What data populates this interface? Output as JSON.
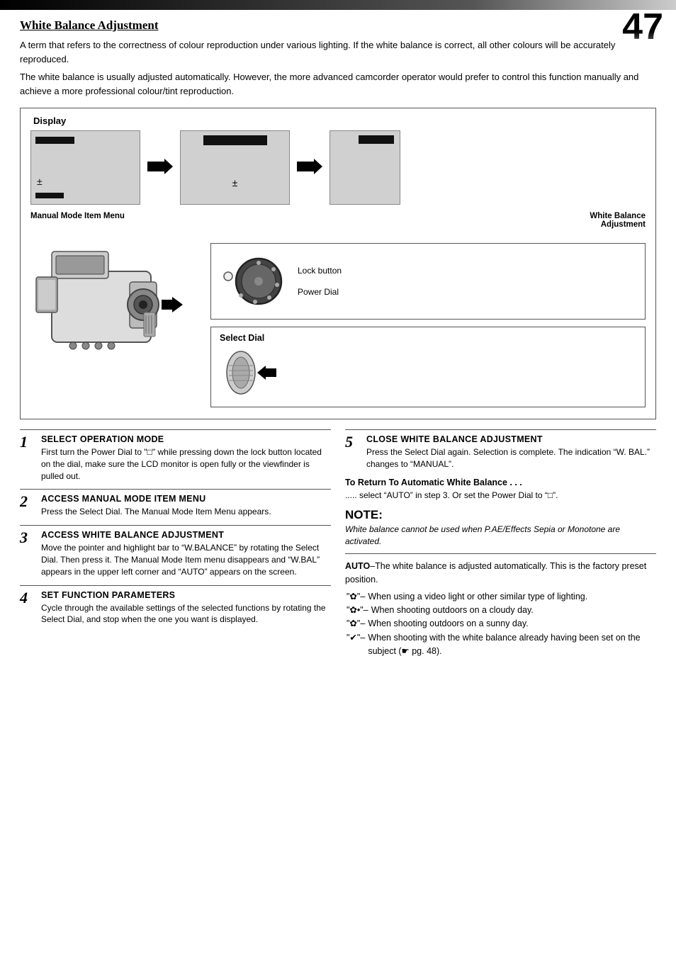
{
  "page": {
    "number": "47",
    "top_bar_gradient": true
  },
  "title": "White Balance Adjustment",
  "intro": [
    "A term that refers to the correctness of colour reproduction under various lighting. If the white balance is correct, all other colours will be accurately reproduced.",
    "The white balance is usually adjusted automatically. However, the more advanced camcorder operator would prefer to control this function manually and achieve a more professional colour/tint reproduction."
  ],
  "diagram": {
    "display_label": "Display",
    "screen_label_left": "Manual Mode Item Menu",
    "screen_label_right": "White Balance Adjustment",
    "lock_button_label": "Lock button",
    "power_dial_label": "Power Dial",
    "select_dial_label": "Select Dial"
  },
  "steps": [
    {
      "number": "1",
      "heading": "SELECT OPERATION MODE",
      "text": "First turn the Power Dial to \"□\" while pressing down the lock button located on the dial, make sure the LCD monitor is open fully or the viewfinder is pulled out."
    },
    {
      "number": "2",
      "heading": "ACCESS MANUAL MODE ITEM MENU",
      "text": "Press the Select Dial. The Manual Mode Item Menu appears."
    },
    {
      "number": "3",
      "heading": "ACCESS WHITE BALANCE ADJUSTMENT",
      "text": "Move the pointer and highlight bar to “W.BALANCE” by rotating the Select Dial. Then press it. The Manual Mode Item menu disappears and “W.BAL” appears in the upper left corner and “AUTO” appears on the screen."
    },
    {
      "number": "4",
      "heading": "SET FUNCTION PARAMETERS",
      "text": "Cycle through the available settings of the selected functions by rotating the Select Dial, and stop when the one you want is displayed."
    },
    {
      "number": "5",
      "heading": "CLOSE WHITE BALANCE ADJUSTMENT",
      "text": "Press the Select Dial again. Selection is complete. The indication “W. BAL.” changes to “MANUAL”."
    }
  ],
  "return_to_awb": {
    "heading": "To Return To Automatic White Balance . . .",
    "text": "..... select “AUTO” in step 3. Or set the Power Dial to “□”."
  },
  "note": {
    "title": "NOTE:",
    "text": "White balance cannot be used when P.AE/Effects Sepia or Monotone are activated."
  },
  "auto_balance": {
    "auto_text": "AUTO–The white balance is adjusted automatically. This is the factory preset position.",
    "items": [
      {
        "symbol": "\"☀\"",
        "dash": "–",
        "text": "When using a video light or other similar type of lighting."
      },
      {
        "symbol": "\"☀•\"",
        "dash": "–",
        "text": "When shooting outdoors on a cloudy day."
      },
      {
        "symbol": "\"☀\"",
        "dash": "–",
        "text": "When shooting outdoors on a sunny day."
      },
      {
        "symbol": "\"✔\"",
        "dash": "–",
        "text": "When shooting with the white balance already having been set on the subject (⚑ pg. 48)."
      }
    ]
  }
}
